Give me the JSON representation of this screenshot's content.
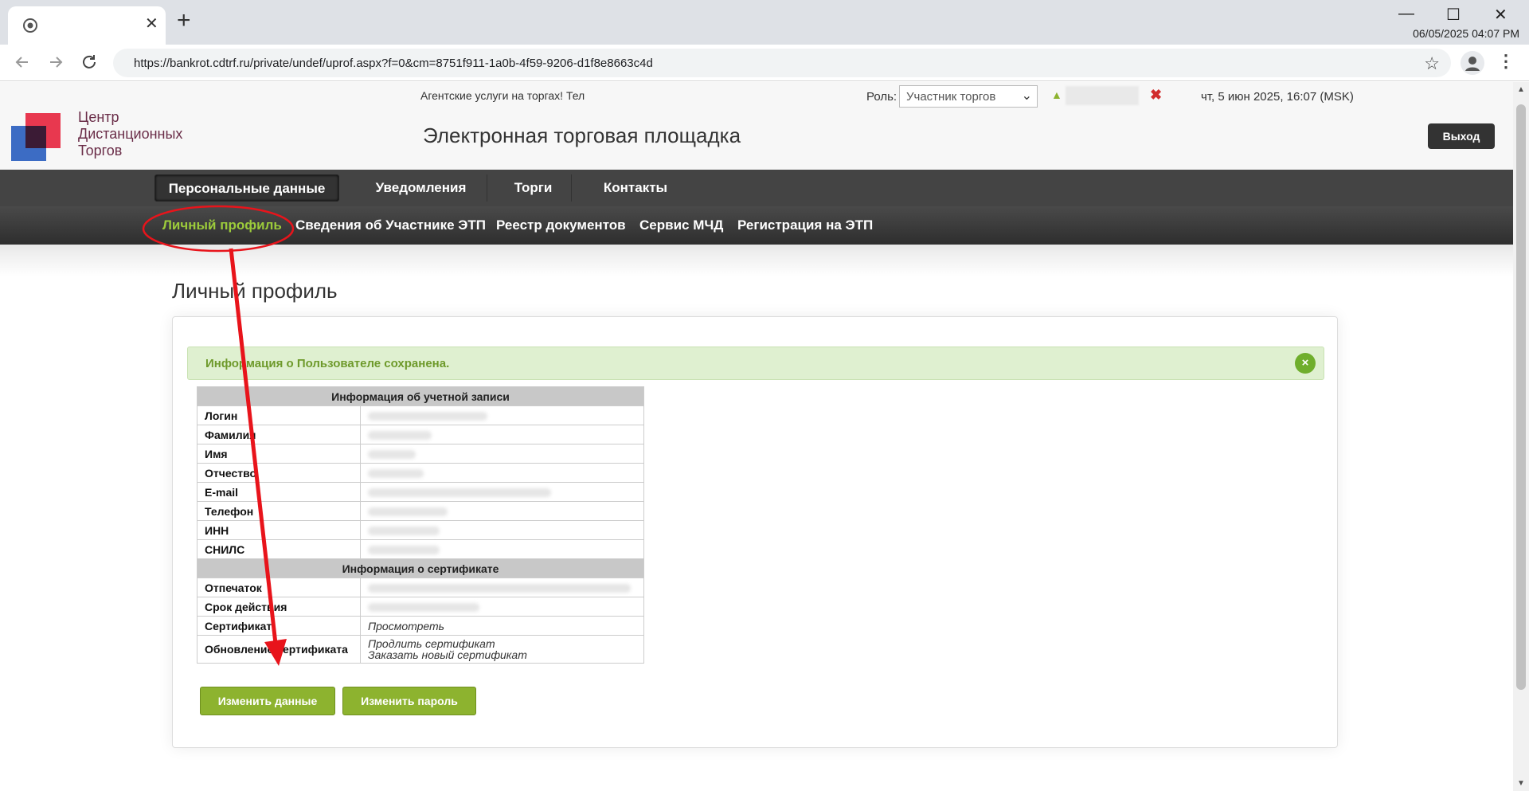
{
  "browser": {
    "url": "https://bankrot.cdtrf.ru/private/undef/uprof.aspx?f=0&cm=8751f911-1a0b-4f59-9206-d1f8e8663c4d",
    "clock": "06/05/2025 04:07 PM"
  },
  "site": {
    "logo_text": [
      "Центр",
      "Дистанционных",
      "Торгов"
    ],
    "ticker": "Агентские услуги на торгах! Тел",
    "role_label": "Роль:",
    "role_value": "Участник торгов",
    "server_date": "чт, 5 июн 2025, 16:07 (MSK)",
    "title": "Электронная торговая площадка",
    "exit_label": "Выход"
  },
  "menu_main": [
    "Персональные данные",
    "Уведомления",
    "Торги",
    "Контакты"
  ],
  "menu_sub": [
    "Личный профиль",
    "Сведения об Участнике ЭТП",
    "Реестр документов",
    "Сервис МЧД",
    "Регистрация на ЭТП"
  ],
  "page": {
    "heading": "Личный профиль",
    "alert": "Информация о Пользователе сохранена.",
    "alert_close": "×"
  },
  "account": {
    "header": "Информация об учетной записи",
    "rows": [
      "Логин",
      "Фамилия",
      "Имя",
      "Отчество",
      "E-mail",
      "Телефон",
      "ИНН",
      "СНИЛС"
    ]
  },
  "certificate": {
    "header": "Информация о сертификате",
    "fingerprint_label": "Отпечаток",
    "validity_label": "Срок действия",
    "cert_label": "Сертификат",
    "cert_link": "Просмотреть",
    "update_label": "Обновление сертификата",
    "renew_link": "Продлить сертификат",
    "order_link": "Заказать новый сертификат"
  },
  "buttons": {
    "edit": "Изменить данные",
    "password": "Изменить пароль"
  },
  "colors": {
    "accent_green": "#8db32f",
    "menu_dark": "#444444",
    "annotation_red": "#e8141b"
  }
}
